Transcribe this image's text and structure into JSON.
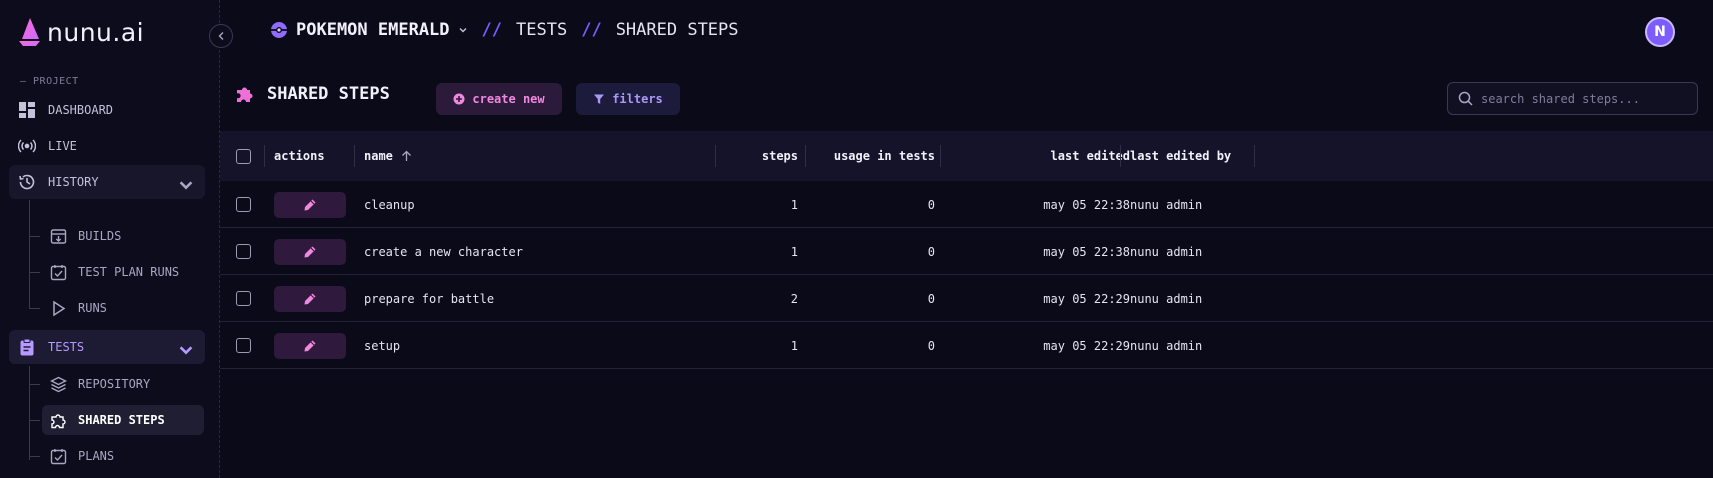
{
  "brand": {
    "name": "nunu.ai"
  },
  "sidebar": {
    "section_label": "— PROJECT",
    "items": [
      {
        "label": "DASHBOARD"
      },
      {
        "label": "LIVE"
      },
      {
        "label": "HISTORY"
      },
      {
        "label": "TESTS"
      }
    ],
    "history_children": [
      {
        "label": "BUILDS"
      },
      {
        "label": "TEST PLAN RUNS"
      },
      {
        "label": "RUNS"
      }
    ],
    "tests_children": [
      {
        "label": "REPOSITORY"
      },
      {
        "label": "SHARED STEPS",
        "active": true
      },
      {
        "label": "PLANS"
      }
    ]
  },
  "breadcrumb": {
    "project": "POKEMON EMERALD",
    "separator": "//",
    "section": "TESTS",
    "page": "SHARED STEPS"
  },
  "user": {
    "avatar_initial": "N"
  },
  "toolbar": {
    "title": "SHARED STEPS",
    "create_label": "create new",
    "filters_label": "filters",
    "search_placeholder": "search shared steps..."
  },
  "table": {
    "columns": {
      "actions": "actions",
      "name": "name",
      "steps": "steps",
      "usage": "usage in tests",
      "last_edited": "last edited",
      "last_edited_by": "last edited by"
    },
    "rows": [
      {
        "name": "cleanup",
        "steps": "1",
        "usage": "0",
        "last_edited": "may 05 22:38",
        "last_edited_by": "nunu admin"
      },
      {
        "name": "create a new character",
        "steps": "1",
        "usage": "0",
        "last_edited": "may 05 22:38",
        "last_edited_by": "nunu admin"
      },
      {
        "name": "prepare for battle",
        "steps": "2",
        "usage": "0",
        "last_edited": "may 05 22:29",
        "last_edited_by": "nunu admin"
      },
      {
        "name": "setup",
        "steps": "1",
        "usage": "0",
        "last_edited": "may 05 22:29",
        "last_edited_by": "nunu admin"
      }
    ]
  },
  "colors": {
    "background": "#0b0a19",
    "accent_purple": "#7c5cff",
    "accent_pink": "#ef89e0"
  }
}
